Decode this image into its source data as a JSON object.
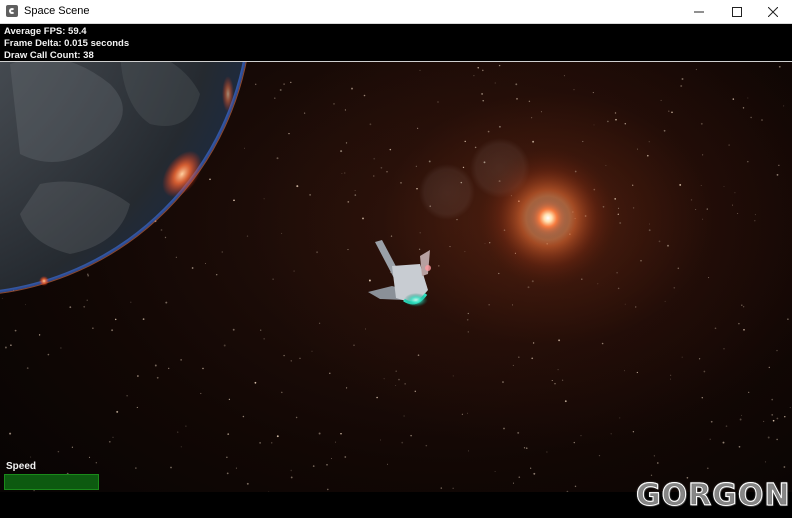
{
  "window": {
    "title": "Space Scene",
    "icon": "gorgon-app-icon",
    "controls": [
      "minimize-icon",
      "maximize-icon",
      "close-icon"
    ]
  },
  "hud": {
    "fps": "Average FPS: 59.4",
    "frame_delta": "Frame Delta: 0.015 seconds",
    "draw_calls": "Draw Call Count: 38"
  },
  "speed": {
    "label": "Speed",
    "value_fraction": 1.0
  },
  "logo": "GORGON",
  "colors": {
    "titlebar": "#ffffff",
    "hud_bg": "#000000",
    "speed_bar": "#0f4a0f",
    "sun": "#ff7a3a",
    "engine_glow": "#2fe0c0"
  }
}
